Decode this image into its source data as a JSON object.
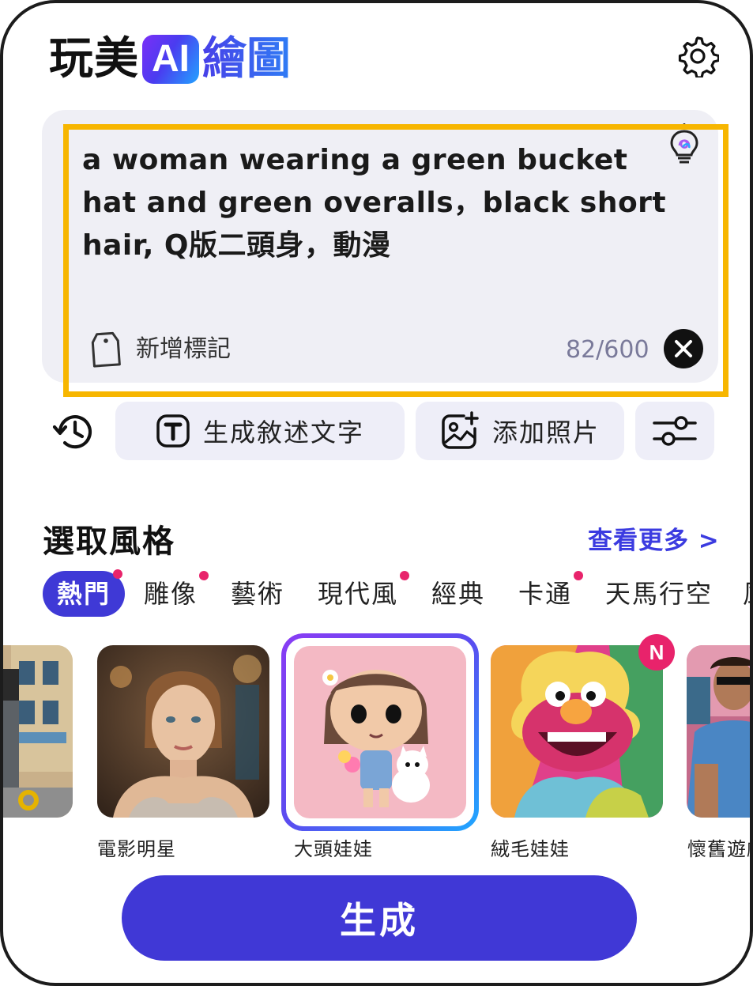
{
  "header": {
    "logo_part1": "玩美",
    "logo_ai": "AI",
    "logo_part2": "繪圖"
  },
  "prompt": {
    "text": "a woman wearing a green   bucket hat and green overalls，black short hair, Q版二頭身，動漫",
    "tag_label": "新增標記",
    "counter": "82/600"
  },
  "actions": {
    "generate_text_label": "生成敘述文字",
    "add_photo_label": "添加照片"
  },
  "styles": {
    "title": "選取風格",
    "see_more": "查看更多 >",
    "tabs": [
      {
        "label": "熱門"
      },
      {
        "label": "雕像"
      },
      {
        "label": "藝術"
      },
      {
        "label": "現代風"
      },
      {
        "label": "經典"
      },
      {
        "label": "卡通"
      },
      {
        "label": "天馬行空"
      },
      {
        "label": "風"
      }
    ],
    "cards": [
      {
        "label": ""
      },
      {
        "label": "電影明星"
      },
      {
        "label": "大頭娃娃"
      },
      {
        "label": "絨毛娃娃"
      },
      {
        "label": "懷舊遊戲"
      }
    ],
    "new_badge": "N"
  },
  "generate_button": "生成",
  "colors": {
    "accent": "#4038d6",
    "highlight_border": "#f7b600",
    "notification_dot": "#e8236b",
    "link": "#3b3be0"
  }
}
